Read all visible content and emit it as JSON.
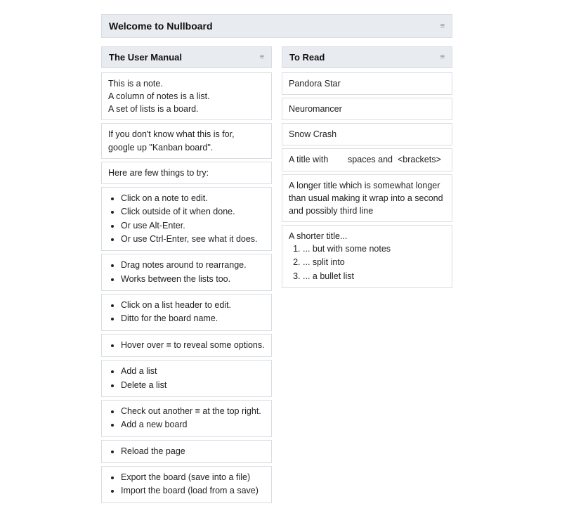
{
  "board": {
    "title": "Welcome to Nullboard"
  },
  "lists": [
    {
      "title": "The User Manual",
      "notes": [
        {
          "type": "text",
          "lines": [
            "This is a note.",
            "A column of notes is a list.",
            "A set of lists is a board."
          ]
        },
        {
          "type": "text",
          "lines": [
            "If you don't know what this is for,",
            "google up \"Kanban board\"."
          ]
        },
        {
          "type": "text",
          "lines": [
            "Here are few things to try:"
          ]
        },
        {
          "type": "ul",
          "items": [
            "Click on a note to edit.",
            "Click outside of it when done.",
            "Or use Alt-Enter.",
            "Or use Ctrl-Enter, see what it does."
          ]
        },
        {
          "type": "ul",
          "items": [
            "Drag notes around to rearrange.",
            "Works between the lists too."
          ]
        },
        {
          "type": "ul",
          "items": [
            "Click on a list header to edit.",
            "Ditto for the board name."
          ]
        },
        {
          "type": "ul",
          "items": [
            "Hover over  ≡  to reveal some options."
          ]
        },
        {
          "type": "ul",
          "items": [
            "Add a list",
            "Delete a list"
          ]
        },
        {
          "type": "ul",
          "items": [
            "Check out another  ≡  at the top right.",
            "Add a new board"
          ]
        },
        {
          "type": "ul",
          "items": [
            "Reload the page"
          ]
        },
        {
          "type": "ul",
          "items": [
            "Export the board  (save into a file)",
            "Import the board  (load from a save)"
          ]
        }
      ]
    },
    {
      "title": "To Read",
      "notes": [
        {
          "type": "text",
          "lines": [
            "Pandora Star"
          ]
        },
        {
          "type": "text",
          "lines": [
            "Neuromancer"
          ]
        },
        {
          "type": "text",
          "lines": [
            "Snow Crash"
          ]
        },
        {
          "type": "text",
          "lines": [
            "A title with        spaces and  <brackets>"
          ]
        },
        {
          "type": "text",
          "lines": [
            "A longer title which is somewhat longer than usual making it wrap into a second and possibly third line"
          ]
        },
        {
          "type": "ol",
          "lead": "A shorter title...",
          "items": [
            "... but with some notes",
            "... split into",
            "... a bullet list"
          ]
        }
      ]
    }
  ]
}
